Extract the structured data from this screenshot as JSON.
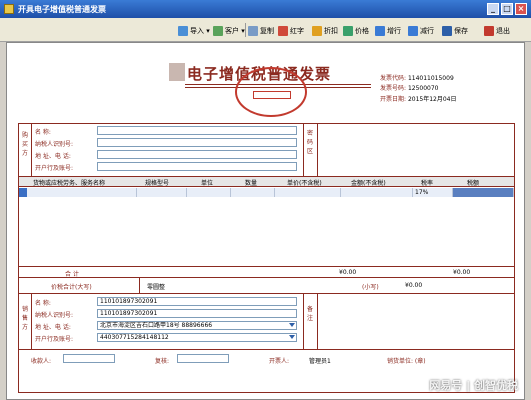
{
  "window": {
    "title": "开具电子增值税普通发票",
    "controls": [
      "_",
      "□",
      "×"
    ]
  },
  "toolbar": {
    "import": "导入",
    "customer": "客户",
    "copy": "复制",
    "red": "红字",
    "discount": "折扣",
    "price": "价格",
    "add_row": "增行",
    "del_row": "减行",
    "save": "保存",
    "exit": "退出"
  },
  "invoice": {
    "heading": "电子增值税普通发票",
    "meta": {
      "code_label": "发票代码:",
      "code": "114011015009",
      "number_label": "发票号码:",
      "number": "12500070",
      "date_label": "开票日期:",
      "date": "2015年12月04日"
    },
    "buyer": {
      "side_label": "购买方",
      "name_label": "名 称:",
      "taxid_label": "纳税人识别号:",
      "addr_label": "地 址、电 话:",
      "bank_label": "开户行及账号:",
      "name": "",
      "taxid": "",
      "addr": "",
      "bank": ""
    },
    "pwd_label": "密码区",
    "columns": [
      "货物或应税劳务、服务名称",
      "规格型号",
      "单位",
      "数量",
      "单价(不含税)",
      "金额(不含税)",
      "税率",
      "税额"
    ],
    "rows": [
      {
        "name": "",
        "spec": "",
        "unit": "",
        "qty": "",
        "price": "",
        "amount": "",
        "rate": "17%",
        "tax": ""
      }
    ],
    "total_label": "合 计",
    "total_amount": "¥0.00",
    "total_tax": "¥0.00",
    "grand_label": "价税合计(大写)",
    "grand_words": "零圆整",
    "small_label": "(小写)",
    "small_value": "¥0.00",
    "seller": {
      "side_label": "销售方",
      "name_label": "名 称:",
      "taxid_label": "纳税人识别号:",
      "addr_label": "地 址、电 话:",
      "bank_label": "开户行及账号:",
      "name": "110101897302091",
      "taxid": "110101897302091",
      "addr": "北京市海淀区吉石口路甲18号 88896666",
      "bank": "440307715284148112"
    },
    "remark_label": "备注",
    "footer": {
      "payee_label": "收款人:",
      "payee": "",
      "review_label": "复核:",
      "review": "",
      "issuer_label": "开票人:",
      "issuer": "管理员1",
      "seller_label": "销货单位: (章)"
    }
  },
  "watermark": "网易号 | 创智优税"
}
